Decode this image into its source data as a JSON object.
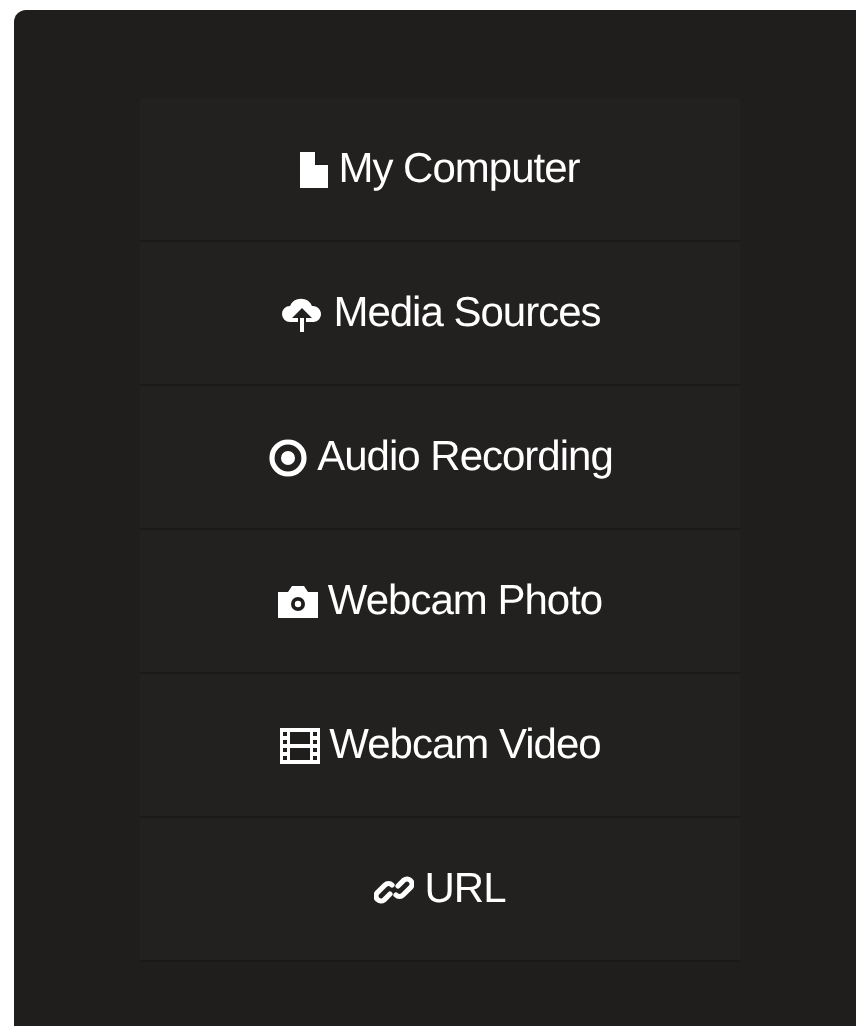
{
  "menu": {
    "items": [
      {
        "kind": "file",
        "label": "My Computer"
      },
      {
        "kind": "cloud",
        "label": "Media Sources"
      },
      {
        "kind": "record",
        "label": "Audio Recording"
      },
      {
        "kind": "camera",
        "label": "Webcam Photo"
      },
      {
        "kind": "film",
        "label": "Webcam Video"
      },
      {
        "kind": "link",
        "label": "URL"
      }
    ]
  }
}
